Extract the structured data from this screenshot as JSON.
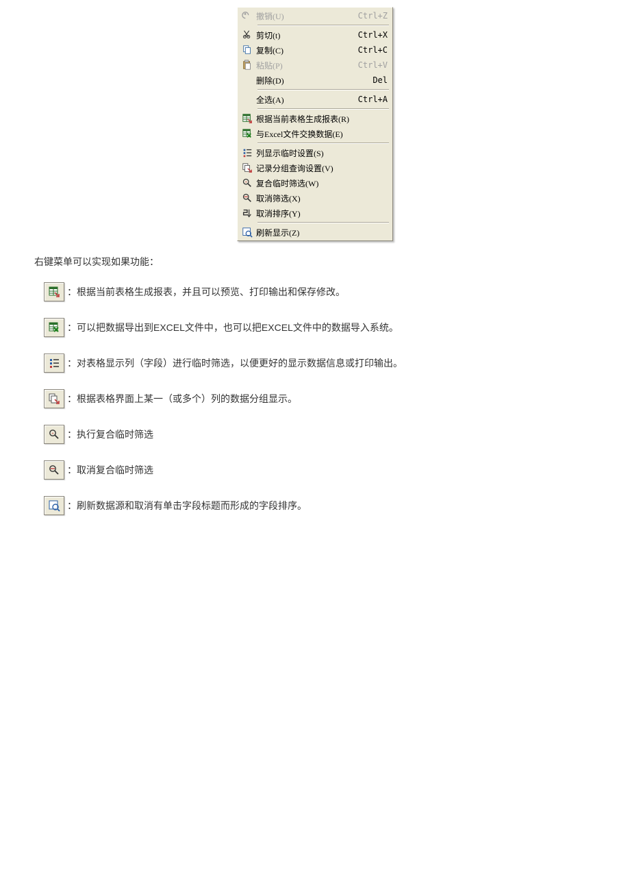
{
  "menu": {
    "items": [
      {
        "icon": "undo",
        "label": "撤销(U)",
        "shortcut": "Ctrl+Z",
        "disabled": true
      },
      {
        "sep": true
      },
      {
        "icon": "cut",
        "label": "剪切(t)",
        "shortcut": "Ctrl+X",
        "disabled": false
      },
      {
        "icon": "copy",
        "label": "复制(C)",
        "shortcut": "Ctrl+C",
        "disabled": false
      },
      {
        "icon": "paste",
        "label": "粘贴(P)",
        "shortcut": "Ctrl+V",
        "disabled": true
      },
      {
        "icon": "",
        "label": "删除(D)",
        "shortcut": "Del",
        "disabled": false
      },
      {
        "sep": true
      },
      {
        "icon": "",
        "label": "全选(A)",
        "shortcut": "Ctrl+A",
        "disabled": false
      },
      {
        "sep": true
      },
      {
        "icon": "report",
        "label": "根据当前表格生成报表(R)",
        "shortcut": "",
        "disabled": false
      },
      {
        "icon": "excel",
        "label": "与Excel文件交换数据(E)",
        "shortcut": "",
        "disabled": false
      },
      {
        "sep": true
      },
      {
        "icon": "columns",
        "label": "列显示临时设置(S)",
        "shortcut": "",
        "disabled": false
      },
      {
        "icon": "group",
        "label": "记录分组查询设置(V)",
        "shortcut": "",
        "disabled": false
      },
      {
        "icon": "filter",
        "label": "复合临时筛选(W)",
        "shortcut": "",
        "disabled": false
      },
      {
        "icon": "nofilter",
        "label": "取消筛选(X)",
        "shortcut": "",
        "disabled": false
      },
      {
        "icon": "nosort",
        "label": "取消排序(Y)",
        "shortcut": "",
        "disabled": false
      },
      {
        "sep": true
      },
      {
        "icon": "refresh",
        "label": "刷新显示(Z)",
        "shortcut": "",
        "disabled": false
      }
    ]
  },
  "intro": "右键菜单可以实现如果功能：",
  "descriptions": [
    {
      "icon": "report",
      "text": "：根据当前表格生成报表，并且可以预览、打印输出和保存修改。"
    },
    {
      "icon": "excel",
      "text": "：可以把数据导出到EXCEL文件中，也可以把EXCEL文件中的数据导入系统。"
    },
    {
      "icon": "columns",
      "text": "：对表格显示列（字段）进行临时筛选，以便更好的显示数据信息或打印输出。"
    },
    {
      "icon": "group",
      "text": "：根据表格界面上某一（或多个）列的数据分组显示。"
    },
    {
      "icon": "filter",
      "text": "：执行复合临时筛选"
    },
    {
      "icon": "nofilter",
      "text": "：取消复合临时筛选"
    },
    {
      "icon": "refresh",
      "text": "：刷新数据源和取消有单击字段标题而形成的字段排序。"
    }
  ]
}
